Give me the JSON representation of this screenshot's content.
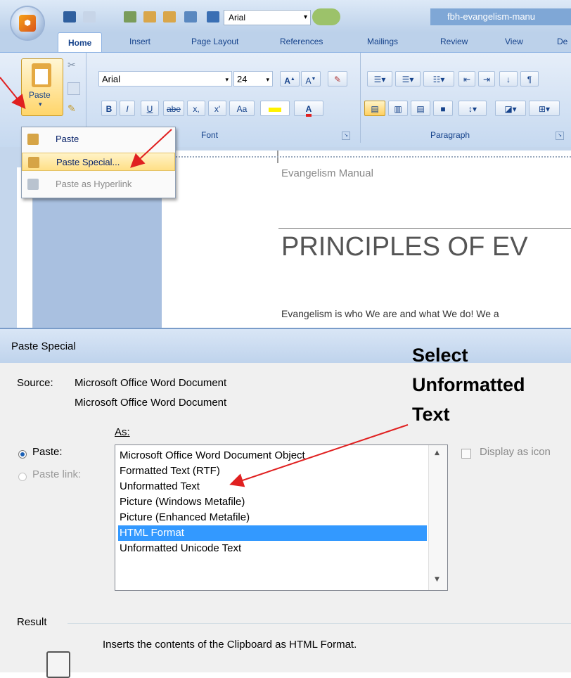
{
  "window": {
    "title": "fbh-evangelism-manu"
  },
  "quick_access": {
    "font_name": "Arial"
  },
  "ribbon": {
    "tabs": [
      "Home",
      "Insert",
      "Page Layout",
      "References",
      "Mailings",
      "Review",
      "View",
      "De"
    ],
    "active_tab": "Home",
    "paste_label": "Paste",
    "font_name": "Arial",
    "font_size": "24",
    "group_font": "Font",
    "group_paragraph": "Paragraph",
    "bold": "B",
    "italic": "I",
    "underline": "U",
    "strike": "abe",
    "subscript": "x,",
    "superscript": "x'",
    "change_case": "Aa"
  },
  "paste_menu": {
    "items": [
      {
        "label": "Paste",
        "highlight": false,
        "disabled": false
      },
      {
        "label": "Paste Special...",
        "highlight": true,
        "disabled": false
      },
      {
        "label": "Paste as Hyperlink",
        "highlight": false,
        "disabled": true
      }
    ]
  },
  "document": {
    "header_text": "Evangelism Manual",
    "heading": "PRINCIPLES OF EV",
    "body": "Evangelism is who We are and what We do!  We a"
  },
  "dialog": {
    "title": "Paste Special",
    "source_label": "Source:",
    "source_line1": "Microsoft Office Word Document",
    "source_line2": "Microsoft Office Word Document",
    "as_label": "As:",
    "paste_option": "Paste:",
    "paste_link_option": "Paste link:",
    "selected_option": "paste",
    "list": [
      "Microsoft Office Word Document Object",
      "Formatted Text (RTF)",
      "Unformatted Text",
      "Picture (Windows Metafile)",
      "Picture (Enhanced Metafile)",
      "HTML Format",
      "Unformatted Unicode Text"
    ],
    "selected_item": "HTML Format",
    "display_as_icon": "Display as icon",
    "result_label": "Result",
    "result_text": "Inserts the contents of the Clipboard as HTML Format."
  },
  "annotation": {
    "line1": "Select",
    "line2": "Unformatted",
    "line3": "Text"
  },
  "colors": {
    "selection": "#3399ff",
    "arrow": "#e02020",
    "ribbon_text": "#15428b"
  }
}
